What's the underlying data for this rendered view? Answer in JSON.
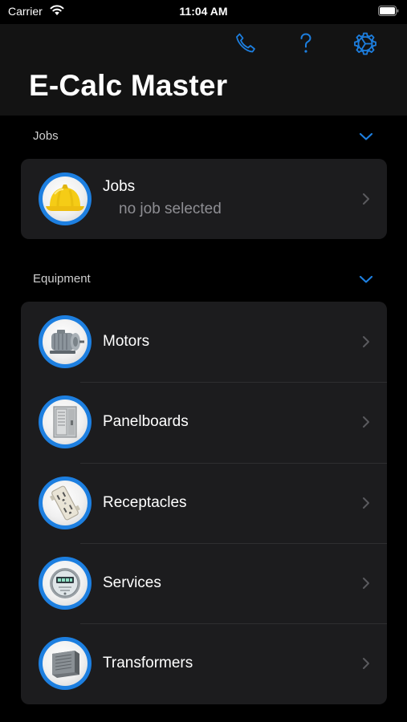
{
  "status_bar": {
    "carrier": "Carrier",
    "time": "11:04 AM"
  },
  "app": {
    "title": "E-Calc Master"
  },
  "colors": {
    "accent": "#1d7fe0",
    "background": "#000000",
    "card": "#1c1c1e"
  },
  "nav_icons": [
    "phone-icon",
    "help-icon",
    "settings-gear-icon"
  ],
  "jobs_section": {
    "header": "Jobs",
    "item": {
      "label": "Jobs",
      "subtitle": "no job selected",
      "icon": "hard-hat-icon"
    }
  },
  "equipment_section": {
    "header": "Equipment",
    "items": [
      {
        "label": "Motors",
        "icon": "motor-icon"
      },
      {
        "label": "Panelboards",
        "icon": "panelboard-icon"
      },
      {
        "label": "Receptacles",
        "icon": "receptacle-icon"
      },
      {
        "label": "Services",
        "icon": "meter-icon"
      },
      {
        "label": "Transformers",
        "icon": "transformer-icon"
      }
    ]
  }
}
